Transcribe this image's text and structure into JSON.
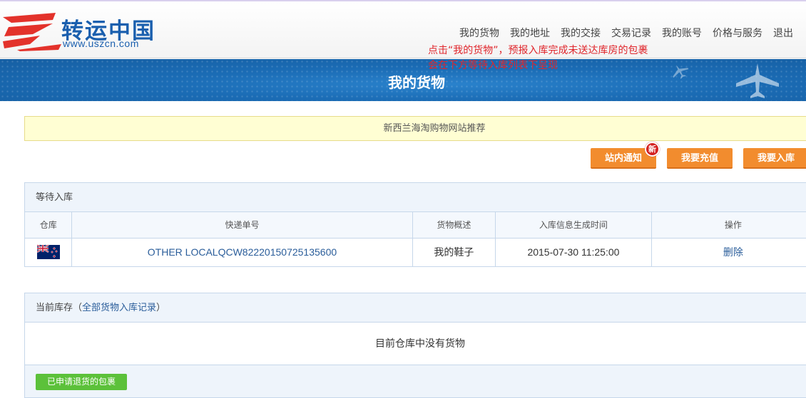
{
  "header": {
    "logo_text": "转运中国",
    "logo_url": "www.uszcn.com",
    "nav": [
      "我的货物",
      "我的地址",
      "我的交接",
      "交易记录",
      "我的账号",
      "价格与服务",
      "退出"
    ],
    "annotation_line1": "点击“我的货物”，预报入库完成未送达库房的包裹",
    "annotation_line2": "会在下方等待入库列表下呈现"
  },
  "banner": {
    "title": "我的货物"
  },
  "promo": {
    "text": "新西兰海淘购物网站推荐"
  },
  "actions": {
    "notify": "站内通知",
    "notify_badge": "新",
    "recharge": "我要充值",
    "stock_in": "我要入库"
  },
  "pending": {
    "title": "等待入库",
    "columns": [
      "仓库",
      "快递单号",
      "货物概述",
      "入库信息生成时间",
      "操作"
    ],
    "rows": [
      {
        "warehouse_flag": "new-zealand-flag",
        "tracking": "OTHER LOCALQCW82220150725135600",
        "description": "我的鞋子",
        "created": "2015-07-30 11:25:00",
        "action": "删除"
      }
    ]
  },
  "inventory": {
    "title": "当前库存",
    "link_text": "全部货物入库记录",
    "empty_text": "目前仓库中没有货物",
    "return_button": "已申请退货的包裹"
  },
  "colors": {
    "accent_orange": "#f28c2e",
    "banner_blue": "#1b6cb5",
    "annotation_red": "#e0262c",
    "green": "#5cc13a"
  }
}
